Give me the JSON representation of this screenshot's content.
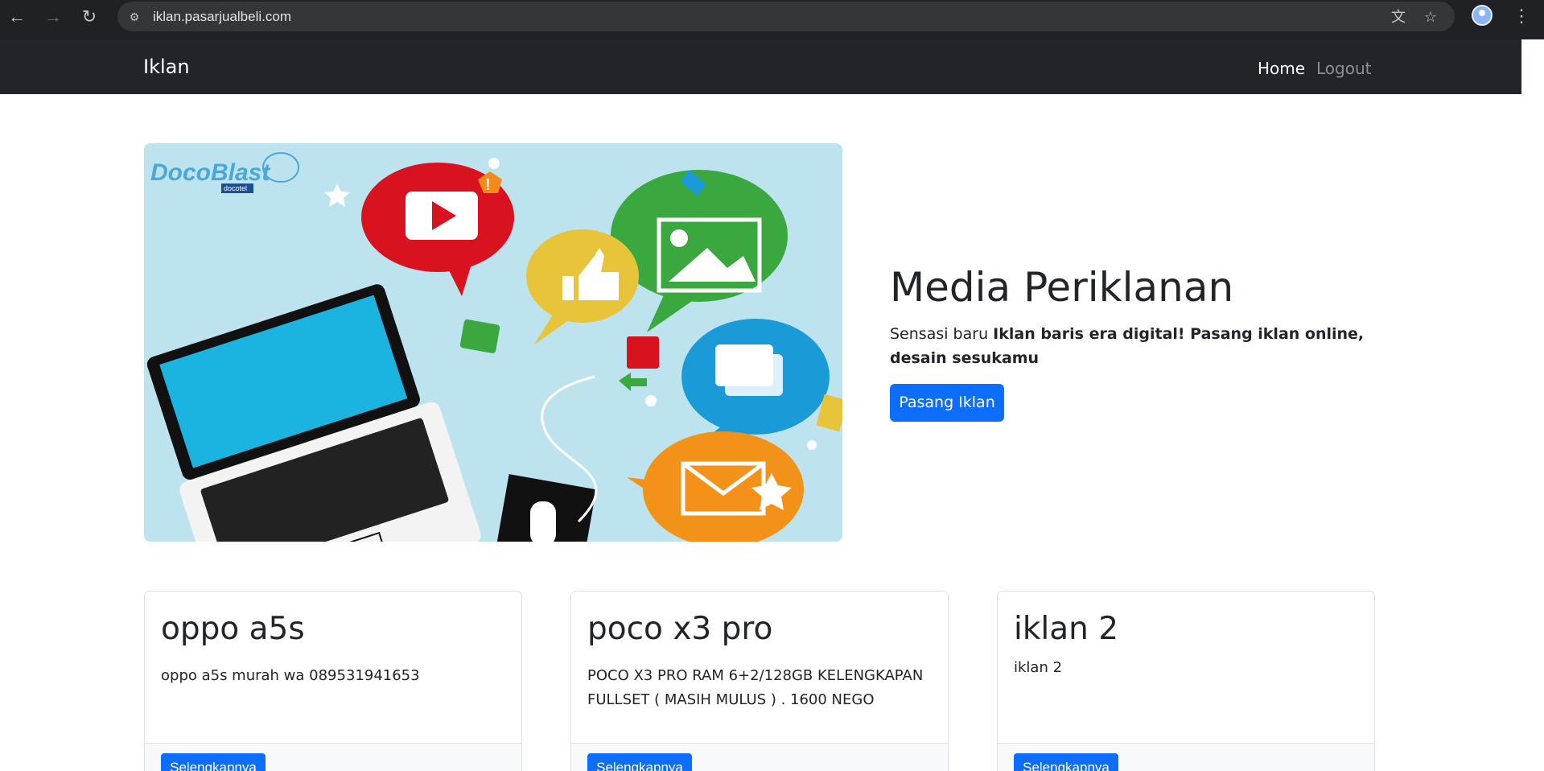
{
  "browser": {
    "url": "iklan.pasarjualbeli.com"
  },
  "navbar": {
    "brand": "Iklan",
    "links": [
      {
        "label": "Home"
      },
      {
        "label": "Logout"
      }
    ]
  },
  "hero": {
    "image_logo": "DocoBlast",
    "image_logo_sub": "docotel",
    "title": "Media Periklanan",
    "text_lead": "Sensasi baru ",
    "text_bold": "Iklan baris era digital! Pasang iklan online, desain sesukamu",
    "button_label": "Pasang Iklan"
  },
  "cards": [
    {
      "title": "oppo a5s",
      "text": "oppo a5s murah wa 089531941653",
      "button_label": "Selengkapnya"
    },
    {
      "title": "poco x3 pro",
      "text": "POCO X3 PRO RAM 6+2/128GB KELENGKAPAN FULLSET ( MASIH MULUS ) . 1600 NEGO",
      "button_label": "Selengkapnya"
    },
    {
      "title": "iklan 2",
      "text": "iklan 2",
      "button_label": "Selengkapnya"
    }
  ],
  "colors": {
    "primary": "#0d6efd",
    "navbar_bg": "#212529",
    "hero_bg": "#bde3ee"
  }
}
